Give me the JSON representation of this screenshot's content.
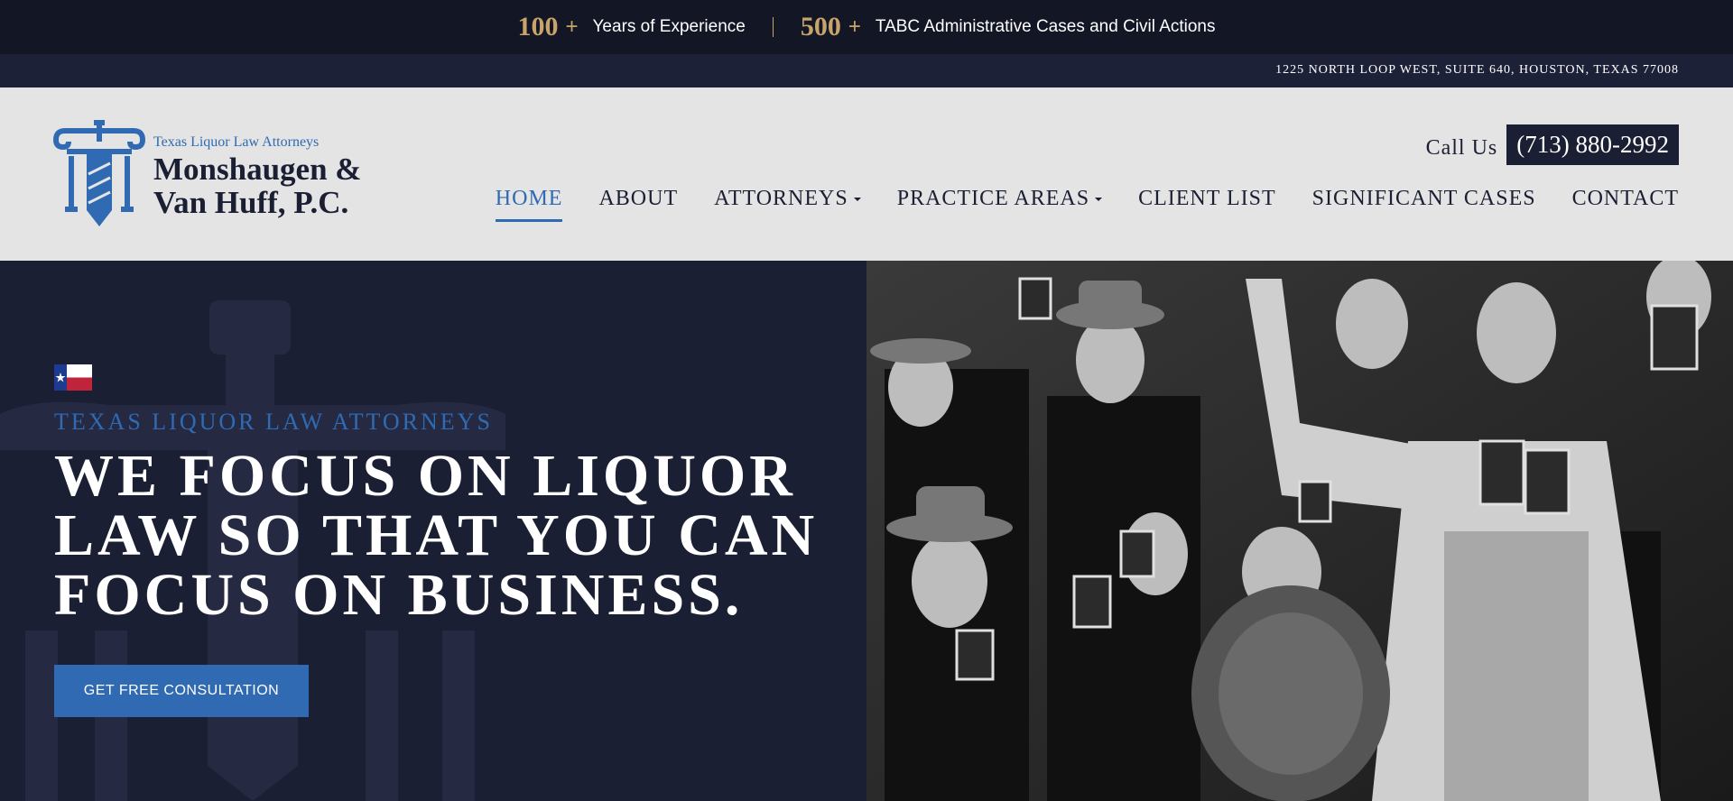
{
  "stats": [
    {
      "number": "100",
      "plus": "+",
      "label": "Years of Experience"
    },
    {
      "number": "500",
      "plus": "+",
      "label": "TABC Administrative Cases and Civil Actions"
    }
  ],
  "address": "1225 NORTH LOOP WEST, SUITE 640, HOUSTON, TEXAS 77008",
  "logo": {
    "tagline": "Texas Liquor Law Attorneys",
    "name_line1": "Monshaugen &",
    "name_line2": "Van Huff, P.C.",
    "icon": "pillar-sword-logo"
  },
  "call": {
    "label": "Call Us",
    "phone": "(713) 880-2992"
  },
  "nav": [
    {
      "label": "HOME",
      "active": true
    },
    {
      "label": "ABOUT"
    },
    {
      "label": "ATTORNEYS",
      "dropdown": true
    },
    {
      "label": "PRACTICE AREAS",
      "dropdown": true
    },
    {
      "label": "CLIENT LIST"
    },
    {
      "label": "SIGNIFICANT CASES"
    },
    {
      "label": "CONTACT"
    }
  ],
  "hero": {
    "flag_icon": "texas-flag-icon",
    "eyebrow": "TEXAS LIQUOR LAW ATTORNEYS",
    "headline_line1": "WE FOCUS ON LIQUOR",
    "headline_line2": "LAW SO THAT YOU CAN",
    "headline_line3": "FOCUS ON BUSINESS.",
    "cta": "GET FREE CONSULTATION"
  },
  "colors": {
    "navy": "#1b1f33",
    "gold": "#c8a46a",
    "brand_blue": "#2f6ab3",
    "header_bg": "#e4e4e4"
  }
}
